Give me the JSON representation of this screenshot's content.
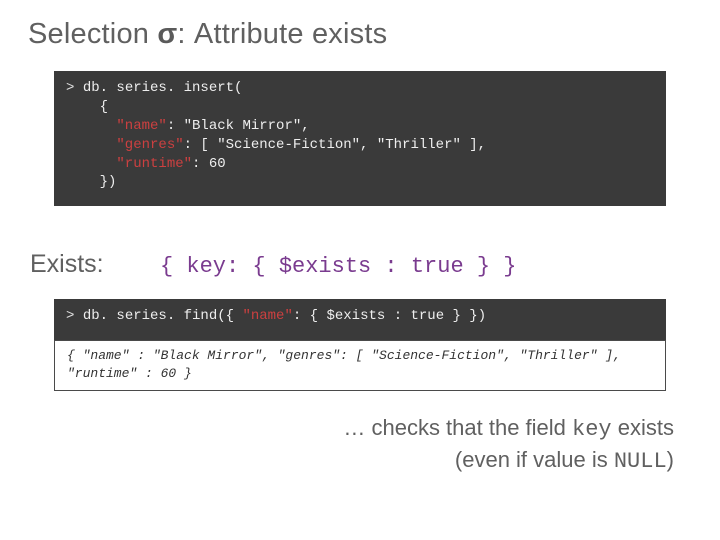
{
  "title": {
    "prefix": "Selection ",
    "sigma": "σ",
    "suffix": ": Attribute exists"
  },
  "code_insert": {
    "l1_prompt": "> ",
    "l1_cmd": "db. series. insert(",
    "l2": "    {",
    "l3_key": "      \"name\"",
    "l3_rest": ": \"Black Mirror\",",
    "l4_key": "      \"genres\"",
    "l4_rest": ": [ \"Science-Fiction\", \"Thriller\" ],",
    "l5_key": "      \"runtime\"",
    "l5_rest": ": 60",
    "l6": "    })"
  },
  "exists": {
    "label": "Exists:",
    "expr": "{ key: { $exists : true } }"
  },
  "code_find": {
    "prompt": "> ",
    "cmd_a": "db. series. find({ ",
    "key": "\"name\"",
    "cmd_b": ": { $exists : true } })"
  },
  "result": "{ \"name\" : \"Black Mirror\", \"genres\": [ \"Science-Fiction\", \"Thriller\" ], \"runtime\" : 60 }",
  "caption": {
    "line1_a": "… checks that the field ",
    "line1_key": "key",
    "line1_b": " exists",
    "line2_a": "(even if value is ",
    "line2_null": "NULL",
    "line2_b": ")"
  }
}
